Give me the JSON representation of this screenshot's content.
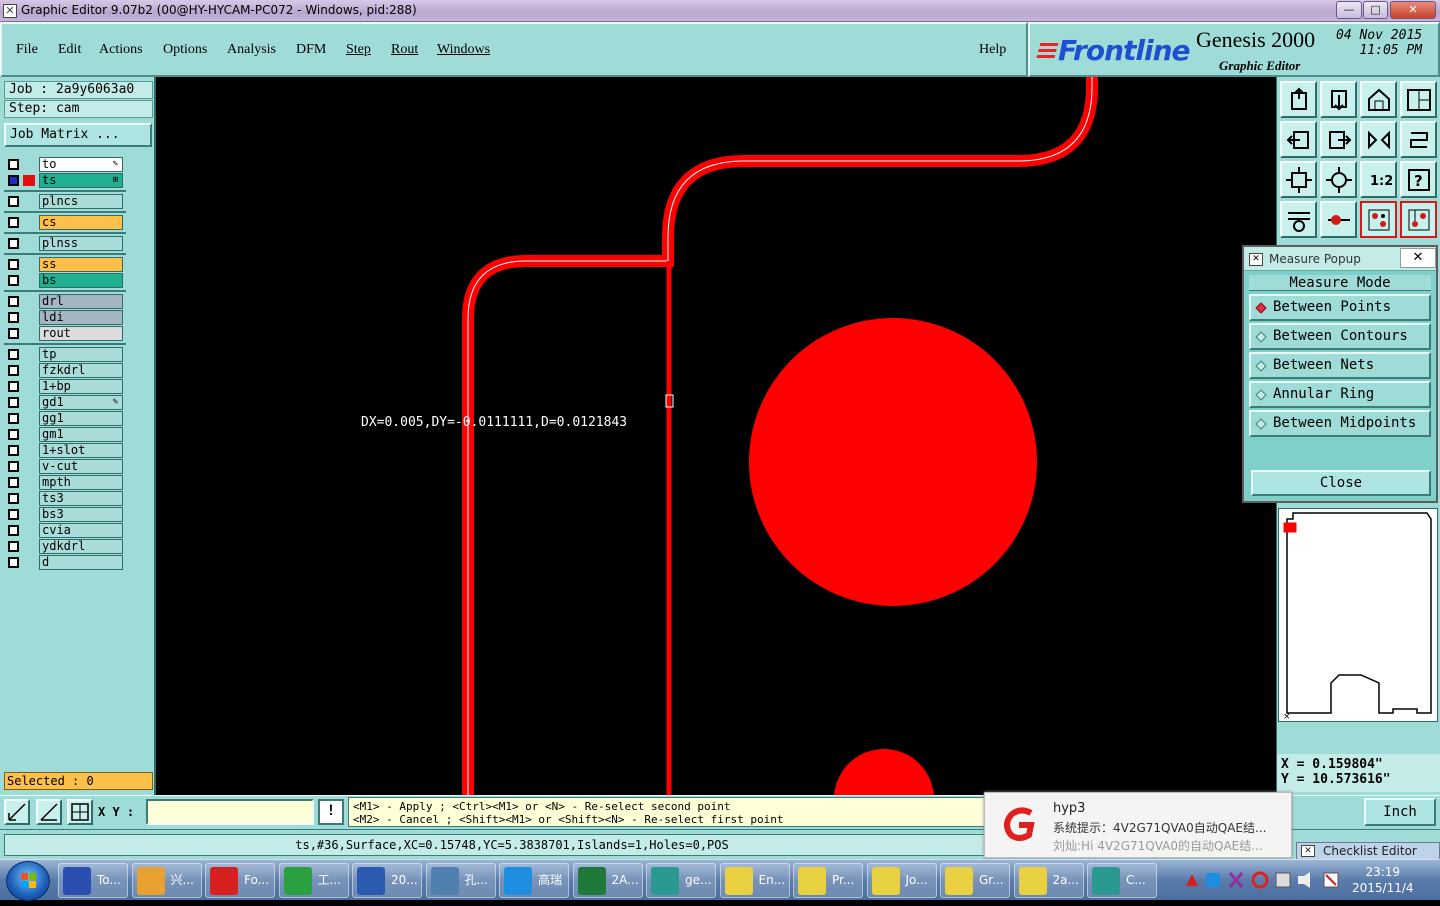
{
  "window": {
    "title": "Graphic Editor 9.07b2 (00@HY-HYCAM-PC072 - Windows, pid:288)",
    "min": "—",
    "max": "□",
    "close": "✕"
  },
  "menu": {
    "items": [
      "File",
      "Edit",
      "Actions",
      "Options",
      "Analysis",
      "DFM",
      "Step",
      "Rout",
      "Windows"
    ],
    "help": "Help"
  },
  "logo": {
    "brand": "Frontline",
    "product": "Genesis 2000",
    "subtitle": "Graphic Editor",
    "date": "04 Nov 2015",
    "time": "11:05 PM"
  },
  "job": {
    "job_label": "Job  : 2a9y6063a0",
    "step_label": "Step: cam",
    "matrix_button": "Job Matrix ..."
  },
  "layers": [
    {
      "name": "to",
      "color": "#ffffff",
      "checked": false,
      "mark": "✎"
    },
    {
      "name": "ts",
      "color": "#20b090",
      "checked": true,
      "mark": "⊞",
      "swatch": "#e01010"
    },
    {
      "name": "plncs",
      "color": "#a9dcd8",
      "checked": false
    },
    {
      "name": "cs",
      "color": "#ffc04a",
      "checked": false
    },
    {
      "name": "plnss",
      "color": "#a9dcd8",
      "checked": false
    },
    {
      "name": "ss",
      "color": "#ffc04a",
      "checked": false
    },
    {
      "name": "bs",
      "color": "#20b090",
      "checked": false
    },
    {
      "name": "drl",
      "color": "#a3b6c2",
      "checked": false
    },
    {
      "name": "ldi",
      "color": "#a3b6c2",
      "checked": false
    },
    {
      "name": "rout",
      "color": "#dcdcdc",
      "checked": false
    },
    {
      "name": "tp",
      "color": "#a9dcd8",
      "checked": false
    },
    {
      "name": "fzkdrl",
      "color": "#a9dcd8",
      "checked": false
    },
    {
      "name": "1+bp",
      "color": "#a9dcd8",
      "checked": false
    },
    {
      "name": "gd1",
      "color": "#a9dcd8",
      "checked": false,
      "mark": "✎"
    },
    {
      "name": "gg1",
      "color": "#a9dcd8",
      "checked": false
    },
    {
      "name": "gm1",
      "color": "#a9dcd8",
      "checked": false
    },
    {
      "name": "1+slot",
      "color": "#a9dcd8",
      "checked": false
    },
    {
      "name": "v-cut",
      "color": "#a9dcd8",
      "checked": false
    },
    {
      "name": "mpth",
      "color": "#a9dcd8",
      "checked": false
    },
    {
      "name": "ts3",
      "color": "#a9dcd8",
      "checked": false
    },
    {
      "name": "bs3",
      "color": "#a9dcd8",
      "checked": false
    },
    {
      "name": "cvia",
      "color": "#a9dcd8",
      "checked": false
    },
    {
      "name": "ydkdrl",
      "color": "#a9dcd8",
      "checked": false
    },
    {
      "name": "d",
      "color": "#a9dcd8",
      "checked": false
    }
  ],
  "selected": "Selected : 0",
  "canvas": {
    "measure_text": "DX=0.005,DY=-0.0111111,D=0.0121843",
    "feature_color": "#ff0000"
  },
  "popup": {
    "title": "Measure Popup",
    "close_x": "✕",
    "mode_label": "Measure Mode",
    "modes": [
      "Between Points",
      "Between Contours",
      "Between Nets",
      "Annular Ring",
      "Between Midpoints"
    ],
    "active_mode": 0,
    "close_button": "Close"
  },
  "coords": {
    "x": "X  = 0.159804\"",
    "y": "Y  = 10.573616\""
  },
  "bottom": {
    "xy_label": "X Y :",
    "xy_value": "",
    "exclaim": "!",
    "hint1": "<M1> - Apply   ; <Ctrl><M1> or <N> - Re-select second point",
    "hint2": "<M2> - Cancel ; <Shift><M1> or <Shift><N> - Re-select first point",
    "units": "Inch",
    "status": "ts,#36,Surface,XC=0.15748,YC=5.3838701,Islands=1,Holes=0,POS"
  },
  "notification": {
    "title": "hyp3",
    "line1": "系统提示：4V2G71QVA0自动QAE结...",
    "line2": "刘灿:Hi 4V2G71QVA0的自动QAE结..."
  },
  "checklist": "Checklist Editor",
  "taskbar": {
    "items": [
      {
        "label": "To...",
        "icon": "floppy-icon",
        "color": "#2a4fb0"
      },
      {
        "label": "兴...",
        "icon": "shell-icon",
        "color": "#e8a030"
      },
      {
        "label": "Fo...",
        "icon": "genesis-icon",
        "color": "#d82020"
      },
      {
        "label": "工...",
        "icon": "p-icon",
        "color": "#2aa040"
      },
      {
        "label": "20...",
        "icon": "word-icon",
        "color": "#2a5bb0"
      },
      {
        "label": "孔...",
        "icon": "image-icon",
        "color": "#5080b0"
      },
      {
        "label": "高瑞",
        "icon": "f-icon",
        "color": "#1f8ee0"
      },
      {
        "label": "2A...",
        "icon": "excel-icon",
        "color": "#1f7a3a"
      },
      {
        "label": "ge...",
        "icon": "eye-icon",
        "color": "#2a9a90"
      },
      {
        "label": "En...",
        "icon": "x-window-icon",
        "color": "#e8d040"
      },
      {
        "label": "Pr...",
        "icon": "x-window-icon",
        "color": "#e8d040"
      },
      {
        "label": "Jo...",
        "icon": "x-window-icon",
        "color": "#e8d040"
      },
      {
        "label": "Gr...",
        "icon": "x-window-icon",
        "color": "#e8d040"
      },
      {
        "label": "2a...",
        "icon": "x-window-icon",
        "color": "#e8d040"
      },
      {
        "label": "C...",
        "icon": "eye-icon",
        "color": "#2a9a90"
      }
    ],
    "clock_time": "23:19",
    "clock_date": "2015/11/4"
  }
}
